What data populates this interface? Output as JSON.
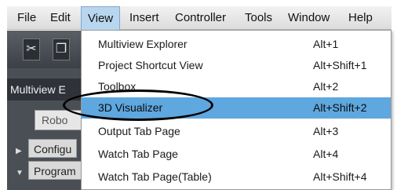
{
  "menubar": {
    "items": [
      {
        "label": "File"
      },
      {
        "label": "Edit"
      },
      {
        "label": "View"
      },
      {
        "label": "Insert"
      },
      {
        "label": "Controller"
      },
      {
        "label": "Tools"
      },
      {
        "label": "Window"
      },
      {
        "label": "Help"
      }
    ]
  },
  "workspace": {
    "panel_title": "Multiview E",
    "robot_tab": "Robo",
    "tree": [
      {
        "label": "Configu"
      },
      {
        "label": "Program"
      }
    ]
  },
  "view_menu": {
    "items": [
      {
        "label": "Multiview Explorer",
        "shortcut": "Alt+1"
      },
      {
        "label": "Project Shortcut View",
        "shortcut": "Alt+Shift+1"
      },
      {
        "label": "Toolbox",
        "shortcut": "Alt+2"
      },
      {
        "label": "3D Visualizer",
        "shortcut": "Alt+Shift+2"
      },
      {
        "label": "Output Tab Page",
        "shortcut": "Alt+3"
      },
      {
        "label": "Watch Tab Page",
        "shortcut": "Alt+4"
      },
      {
        "label": "Watch Tab Page(Table)",
        "shortcut": "Alt+Shift+4"
      }
    ],
    "highlight_color": "#5ea7df"
  }
}
